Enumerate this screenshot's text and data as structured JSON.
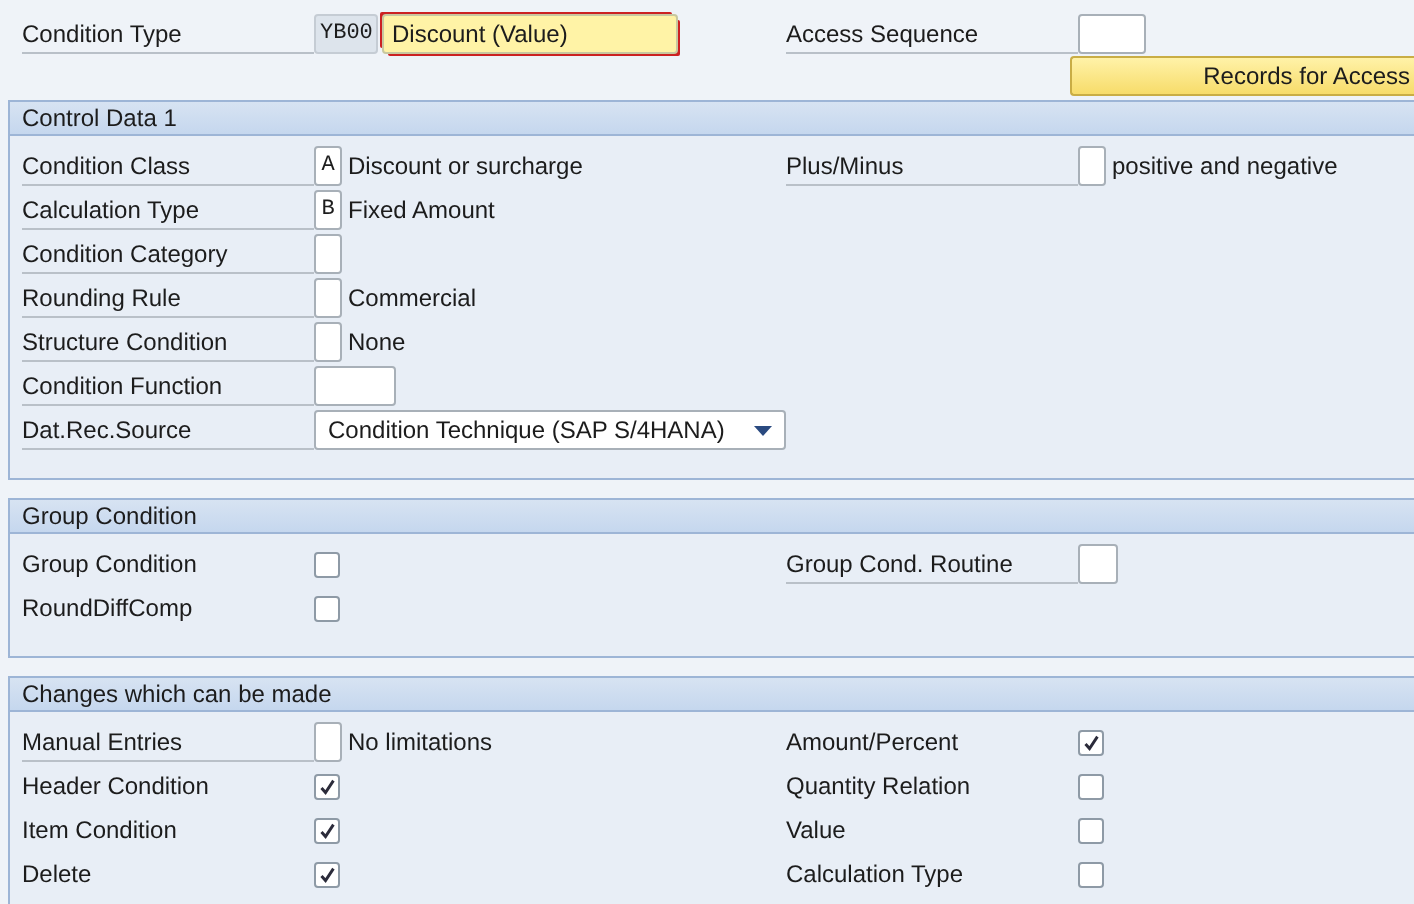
{
  "header": {
    "condition_type": {
      "label": "Condition Type",
      "code": "YB00",
      "value": "Discount (Value)",
      "required": true
    },
    "access_sequence": {
      "label": "Access Sequence"
    },
    "button": "Records for Access"
  },
  "sections": [
    {
      "title": "Control Data 1",
      "rows": [
        {
          "left": {
            "kind": "char",
            "label": "Condition Class",
            "value": "A",
            "text": "Discount or surcharge"
          },
          "right": {
            "kind": "char",
            "label": "Plus/Minus",
            "text": "positive and negative"
          }
        },
        {
          "left": {
            "kind": "char",
            "label": "Calculation Type",
            "value": "B",
            "text": "Fixed Amount"
          }
        },
        {
          "left": {
            "kind": "char",
            "label": "Condition Category"
          }
        },
        {
          "left": {
            "kind": "char",
            "label": "Rounding Rule",
            "text": "Commercial"
          }
        },
        {
          "left": {
            "kind": "char",
            "label": "Structure Condition",
            "text": "None"
          }
        },
        {
          "left": {
            "kind": "field",
            "label": "Condition Function"
          }
        },
        {
          "left": {
            "kind": "dropdown",
            "label": "Dat.Rec.Source",
            "value": "Condition Technique (SAP S/4HANA)"
          }
        }
      ]
    },
    {
      "title": "Group Condition",
      "rows": [
        {
          "left": {
            "kind": "checkbox",
            "label": "Group Condition",
            "checked": false
          },
          "right": {
            "kind": "box",
            "label": "Group Cond. Routine"
          }
        },
        {
          "left": {
            "kind": "checkbox",
            "label": "RoundDiffComp",
            "checked": false
          }
        }
      ]
    },
    {
      "title": "Changes which can be made",
      "rows": [
        {
          "left": {
            "kind": "char",
            "label": "Manual Entries",
            "text": "No limitations"
          },
          "right": {
            "kind": "checkbox",
            "label": "Amount/Percent",
            "checked": true
          }
        },
        {
          "left": {
            "kind": "checkbox",
            "label": "Header Condition",
            "checked": true
          },
          "right": {
            "kind": "checkbox",
            "label": "Quantity Relation",
            "checked": false
          }
        },
        {
          "left": {
            "kind": "checkbox",
            "label": "Item Condition",
            "checked": true
          },
          "right": {
            "kind": "checkbox",
            "label": "Value",
            "checked": false
          }
        },
        {
          "left": {
            "kind": "checkbox",
            "label": "Delete",
            "checked": true
          },
          "right": {
            "kind": "checkbox",
            "label": "Calculation Type",
            "checked": false
          }
        }
      ]
    }
  ]
}
